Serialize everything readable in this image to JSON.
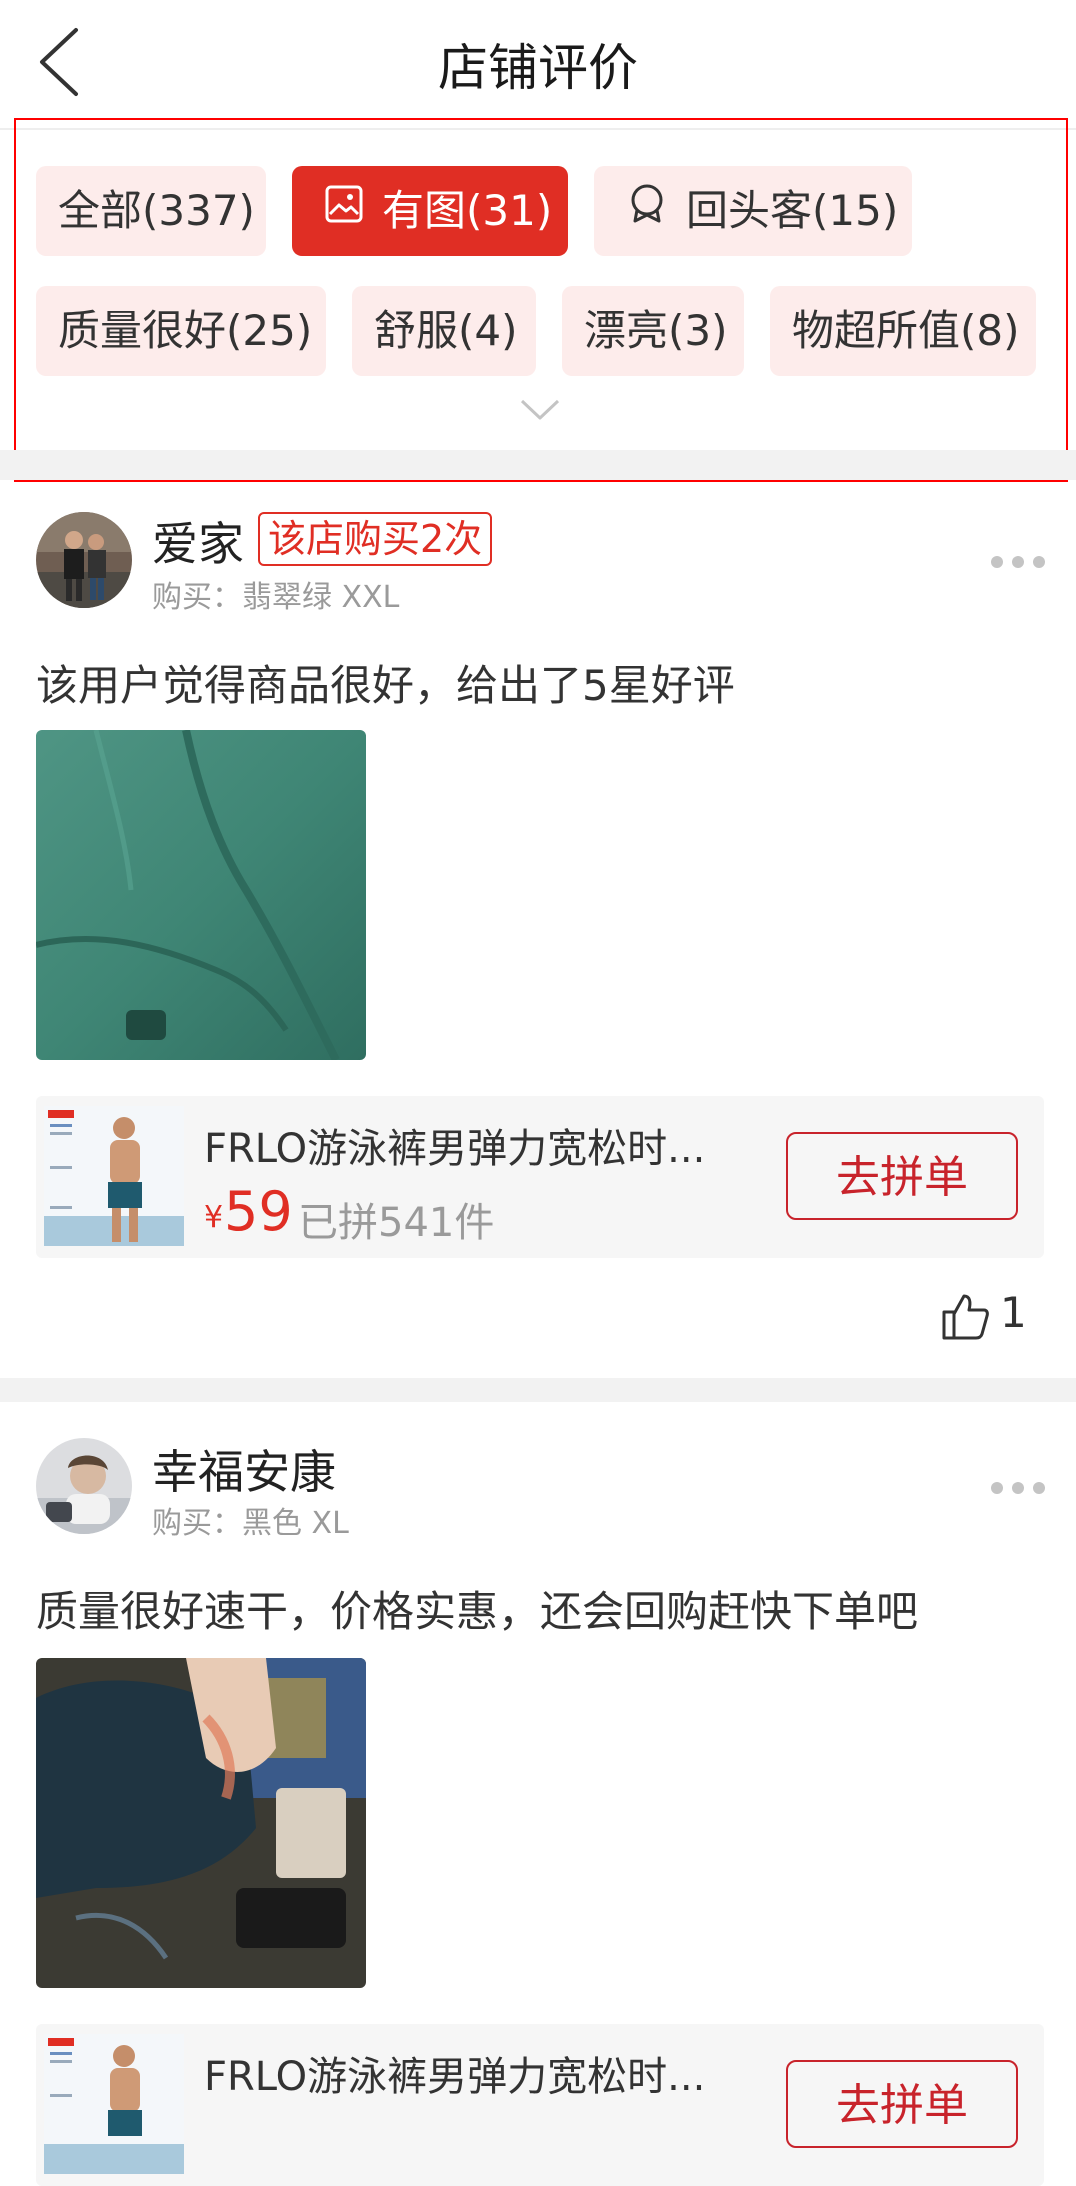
{
  "header": {
    "title": "店铺评价"
  },
  "filters": {
    "tags": [
      {
        "label": "全部(337)"
      },
      {
        "label": "有图(31)",
        "active": true,
        "icon": "image-icon"
      },
      {
        "label": "回头客(15)",
        "icon": "returning-customer-icon"
      },
      {
        "label": "质量很好(25)"
      },
      {
        "label": "舒服(4)"
      },
      {
        "label": "漂亮(3)"
      },
      {
        "label": "物超所值(8)"
      }
    ],
    "expand_icon": "chevron-down-icon"
  },
  "reviews": [
    {
      "user": "爱家",
      "badge": "该店购买2次",
      "purchase": "购买：翡翠绿 XXL",
      "text": "该用户觉得商品很好，给出了5星好评",
      "photo": "teal-fabric-photo",
      "product": {
        "name": "FRLO游泳裤男弹力宽松时...",
        "price_symbol": "¥",
        "price": "59",
        "sold": "已拼541件",
        "button": "去拼单"
      },
      "likes": "1"
    },
    {
      "user": "幸福安康",
      "purchase": "购买：黑色 XL",
      "text": "质量很好速干，价格实惠，还会回购赶快下单吧",
      "photo": "black-shorts-photo",
      "product": {
        "name": "FRLO游泳裤男弹力宽松时...",
        "button": "去拼单"
      }
    }
  ],
  "colors": {
    "accent": "#e02e24",
    "tag_bg": "#fdeceb",
    "divider": "#f2f2f2"
  }
}
